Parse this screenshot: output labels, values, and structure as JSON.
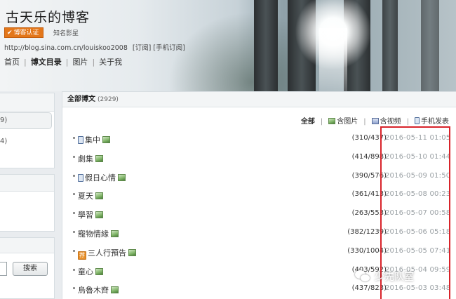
{
  "header": {
    "blog_title": "古天乐的博客",
    "badge_label": "博客认证",
    "star_label": "知名影星",
    "blog_url": "http://blog.sina.com.cn/louiskoo2008",
    "subscribe_label": "[订阅]",
    "mobile_subscribe_label": "[手机订阅]",
    "nav": [
      "首页",
      "博文目录",
      "图片",
      "关于我"
    ],
    "nav_active": "博文目录"
  },
  "sidebar": {
    "category_count_1": "9)",
    "category_count_2": "4)",
    "search_button_label": "搜索"
  },
  "main": {
    "section_title": "全部博文",
    "section_count": "(2929)",
    "filters": {
      "all": "全部",
      "with_images": "含图片",
      "with_video": "含视频",
      "mobile_posts": "手机发表"
    },
    "posts": [
      {
        "title": "集中",
        "count": "(310/437)",
        "date": "2016-05-11 01:05",
        "icon": "mobile"
      },
      {
        "title": "劇集",
        "count": "(414/898)",
        "date": "2016-05-10 01:44",
        "icon": "none"
      },
      {
        "title": "假日心情",
        "count": "(390/576)",
        "date": "2016-05-09 01:50",
        "icon": "mobile"
      },
      {
        "title": "夏天",
        "count": "(361/413)",
        "date": "2016-05-08 00:23",
        "icon": "none"
      },
      {
        "title": "學習",
        "count": "(263/553)",
        "date": "2016-05-07 00:58",
        "icon": "none"
      },
      {
        "title": "寵物情緣",
        "count": "(382/1239)",
        "date": "2016-05-06 05:18",
        "icon": "none"
      },
      {
        "title": "三人行預告",
        "count": "(330/1004)",
        "date": "2016-05-05 07:41",
        "icon": "orange",
        "icon_glyph": "荐"
      },
      {
        "title": "童心",
        "count": "(403/592)",
        "date": "2016-05-04 09:59",
        "icon": "none"
      },
      {
        "title": "烏魯木齊",
        "count": "(437/823)",
        "date": "2016-05-03 03:48",
        "icon": "none"
      }
    ]
  },
  "watermark": {
    "text": "少先队室"
  },
  "colors": {
    "highlight": "#d8232a",
    "badge": "#e3771a"
  }
}
